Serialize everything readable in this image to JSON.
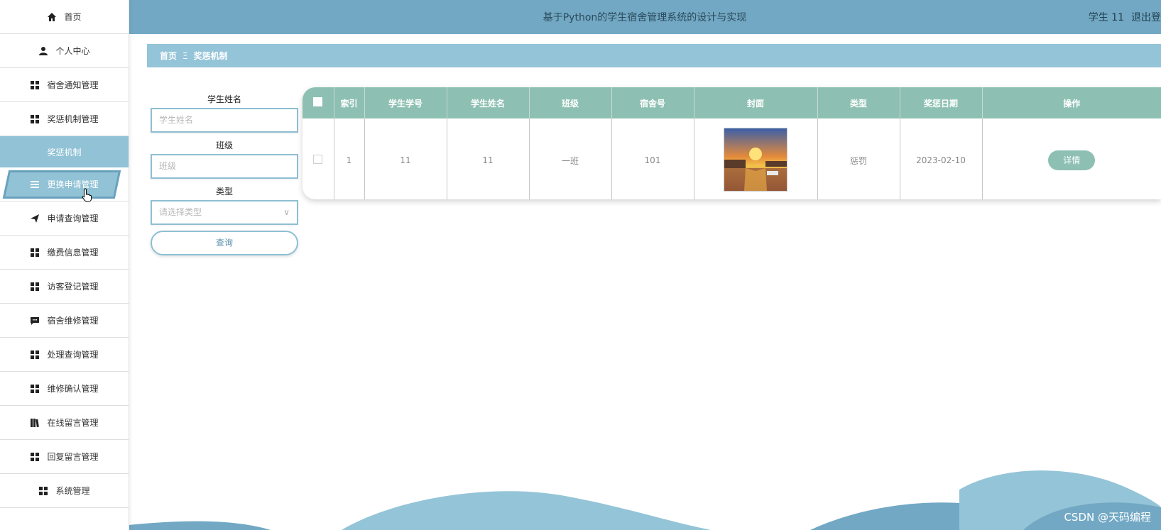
{
  "sidebar": {
    "items": [
      {
        "label": "首页",
        "icon": "home-icon"
      },
      {
        "label": "个人中心",
        "icon": "user-icon"
      },
      {
        "label": "宿舍通知管理",
        "icon": "grid-icon"
      },
      {
        "label": "奖惩机制管理",
        "icon": "grid-icon"
      },
      {
        "label": "奖惩机制",
        "icon": ""
      },
      {
        "label": "更换申请管理",
        "icon": "menu-icon"
      },
      {
        "label": "申请查询管理",
        "icon": "send-icon"
      },
      {
        "label": "缴费信息管理",
        "icon": "grid-icon"
      },
      {
        "label": "访客登记管理",
        "icon": "grid-icon"
      },
      {
        "label": "宿舍维修管理",
        "icon": "chat-icon"
      },
      {
        "label": "处理查询管理",
        "icon": "grid-icon"
      },
      {
        "label": "维修确认管理",
        "icon": "grid-icon"
      },
      {
        "label": "在线留言管理",
        "icon": "book-icon"
      },
      {
        "label": "回复留言管理",
        "icon": "grid-icon"
      },
      {
        "label": "系统管理",
        "icon": "grid-icon"
      }
    ]
  },
  "header": {
    "title": "基于Python的学生宿舍管理系统的设计与实现",
    "user": "学生 11",
    "logout": "退出登"
  },
  "breadcrumb": {
    "home": "首页",
    "separator": "Ξ",
    "current": "奖惩机制"
  },
  "search": {
    "name_label": "学生姓名",
    "name_placeholder": "学生姓名",
    "class_label": "班级",
    "class_placeholder": "班级",
    "type_label": "类型",
    "type_placeholder": "请选择类型",
    "query_button": "查询"
  },
  "table": {
    "headers": [
      "索引",
      "学生学号",
      "学生姓名",
      "班级",
      "宿舍号",
      "封面",
      "类型",
      "奖惩日期",
      "操作"
    ],
    "rows": [
      {
        "index": "1",
        "student_no": "11",
        "student_name": "11",
        "class": "一班",
        "dorm": "101",
        "type": "惩罚",
        "date": "2023-02-10",
        "action": "详情"
      }
    ]
  },
  "watermark": "CSDN @天码编程",
  "colors": {
    "accent": "#72a8c4",
    "table_header": "#8dc0b2",
    "sidebar_active": "#91c2d6"
  }
}
